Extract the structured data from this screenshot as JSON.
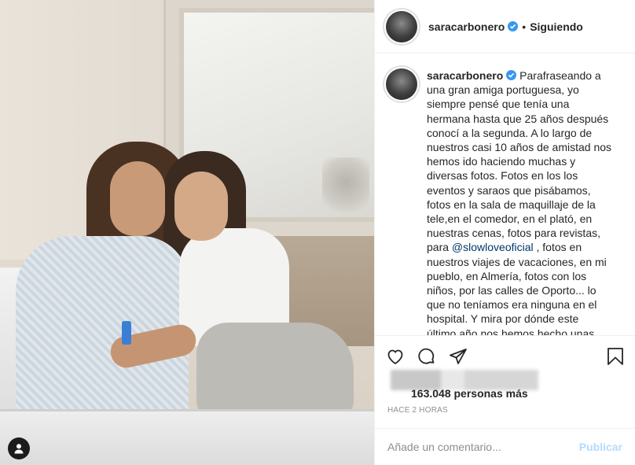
{
  "post": {
    "username": "saracarbonero",
    "follow_label": "Siguiendo",
    "separator": "•",
    "caption_lines": [
      "Parafraseando a",
      "una gran amiga portuguesa, yo",
      "siempre pensé que tenía una",
      "hermana hasta que 25 años después",
      "conocí a la segunda. A lo largo de",
      "nuestros casi 10 años de amistad nos",
      "hemos ido haciendo muchas y",
      "diversas fotos. Fotos en los los",
      "eventos y saraos que pisábamos,",
      "fotos en la sala de maquillaje de la",
      "tele,en el comedor, en el plató, en",
      "nuestras cenas, fotos para revistas,"
    ],
    "caption_mention_prefix": "para ",
    "caption_mention": "@slowloveoficial",
    "caption_mention_suffix": " , fotos en",
    "caption_lines_after": [
      "nuestros viajes de vacaciones, en mi",
      "pueblo, en Almería, fotos con los",
      "niños, por las calles de Oporto... lo",
      "que no teníamos era ninguna en el",
      "hospital. Y mira por dónde este",
      "último año nos hemos hecho unas"
    ],
    "likes_text": "163.048 personas más",
    "time": "HACE 2 HORAS",
    "comment_placeholder": "Añade un comentario...",
    "publish_label": "Publicar"
  },
  "icons": {
    "like": "heart-icon",
    "comment": "comment-icon",
    "share": "share-icon",
    "save": "bookmark-icon",
    "verified": "verified-badge-icon",
    "tags": "user-tag-icon"
  },
  "colors": {
    "verified": "#3897f0",
    "mention": "#00376b",
    "publish_disabled": "#b3dbff"
  }
}
